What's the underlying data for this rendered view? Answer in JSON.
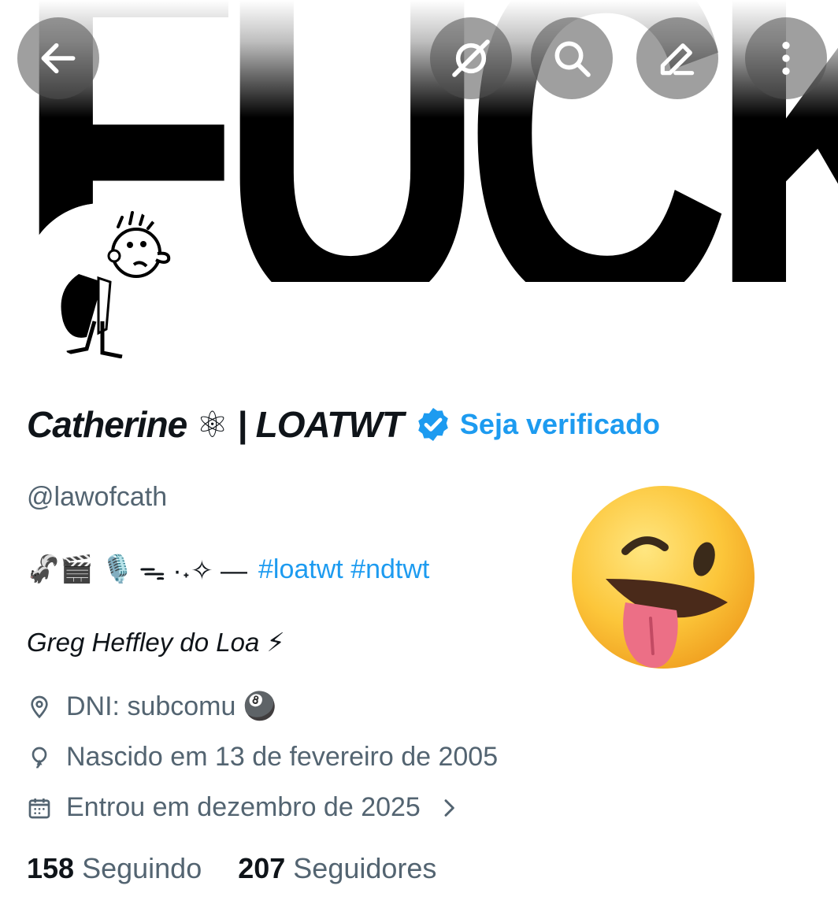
{
  "header": {
    "banner_text": "FUCK",
    "buttons": [
      {
        "name": "back",
        "icon": "arrow-left-icon"
      },
      {
        "name": "grok",
        "icon": "grok-slash-icon"
      },
      {
        "name": "search",
        "icon": "search-icon"
      },
      {
        "name": "edit",
        "icon": "pencil-icon"
      },
      {
        "name": "more",
        "icon": "more-vertical-icon"
      }
    ]
  },
  "profile": {
    "display_name": "Catherine ⚛ | LOATWT",
    "verified_badge_color": "#1d9bf0",
    "get_verified_label": "Seja verificado",
    "handle": "@lawofcath",
    "bio_emojis": "🦨🎬 🎙️ ",
    "bio_symbols": "ᯓ ·˖✧ —",
    "bio_hashtags": "#loatwt #ndtwt",
    "bio_line2": "Greg Heffley do Loa ⚡",
    "location": "DNI: subcomu 🎱",
    "birthday": "Nascido em 13 de fevereiro de 2005",
    "joined": "Entrou em dezembro de 2025",
    "following_count": "158",
    "following_label": "Seguindo",
    "followers_count": "207",
    "followers_label": "Seguidores"
  },
  "colors": {
    "accent": "#1d9bf0",
    "secondary_text": "#536471",
    "primary_text": "#0f1419"
  }
}
